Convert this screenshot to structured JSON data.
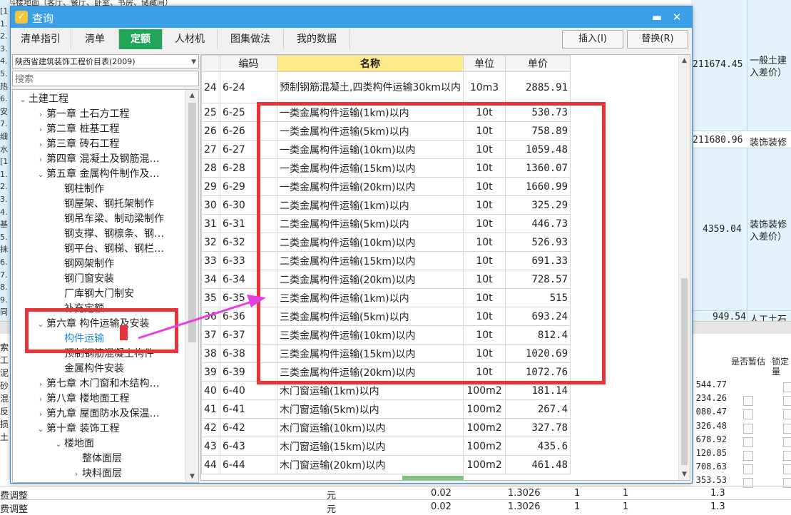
{
  "background": {
    "top_text": "块料楼地面（客厅、餐厅、卧室、书房、储藏间）",
    "left_fragments": [
      "[1",
      "1.",
      "2.",
      "3.",
      "4.",
      "5.",
      "热",
      "6.",
      "安",
      "7.",
      "细",
      "水",
      "[1",
      "1.",
      "2.",
      "3.",
      "4.",
      "基",
      "5.",
      "抹",
      "6.",
      "7.",
      "8.",
      "9.",
      "同",
      "索",
      "工",
      "泥",
      "砂",
      "混",
      "反",
      "损",
      "土"
    ],
    "right_cells": [
      {
        "value": "211674.45",
        "label": "一般土建",
        "label2": "入差价）"
      },
      {
        "value": "211680.96",
        "label": "装饰装修",
        "label2": ""
      },
      {
        "value": "4359.04",
        "label": "装饰装修",
        "label2": "入差价）"
      },
      {
        "value": "949.54",
        "label": "人工土石",
        "label2": ""
      }
    ],
    "lower_headers": {
      "estimate": "是否暂估",
      "lock": "锁定量"
    },
    "lower_values": [
      "544.77",
      "234.26",
      "080.47",
      "326.48",
      "678.92",
      "120.85",
      "708.63",
      "353.53"
    ],
    "bottom_rows": [
      {
        "name": "费调整",
        "unit": "元",
        "v1": "0.02",
        "v2": "1.3026",
        "v3": "1",
        "v4": "1",
        "v5": "1.3"
      },
      {
        "name": "费调整",
        "unit": "元",
        "v1": "0.02",
        "v2": "1.3026",
        "v3": "1",
        "v4": "1",
        "v5": "1.3"
      }
    ]
  },
  "dialog": {
    "title": "查询",
    "minimize_glyph": "▬",
    "close_glyph": "✕",
    "tabs": [
      "清单指引",
      "清单",
      "定额",
      "人材机",
      "图集做法",
      "我的数据"
    ],
    "active_tab": "定额",
    "insert_button": "插入(I)",
    "replace_button": "替换(R)",
    "library_select": "陕西省建筑装饰工程价目表(2009)",
    "search_placeholder": "搜索"
  },
  "tree": [
    {
      "label": "土建工程",
      "toggle": "⌄"
    },
    {
      "label": "第一章  土石方工程",
      "toggle": "›"
    },
    {
      "label": "第二章  桩基工程",
      "toggle": "›"
    },
    {
      "label": "第三章  砖石工程",
      "toggle": "›"
    },
    {
      "label": "第四章  混凝土及钢筋混…",
      "toggle": "›"
    },
    {
      "label": "第五章  金属构件制作及…",
      "toggle": "⌄"
    },
    {
      "label": "钢柱制作",
      "toggle": ""
    },
    {
      "label": "钢屋架、钢托架制作",
      "toggle": ""
    },
    {
      "label": "钢吊车梁、制动梁制作",
      "toggle": ""
    },
    {
      "label": "钢支撑、钢檩条、钢…",
      "toggle": ""
    },
    {
      "label": "钢平台、钢梯、钢栏…",
      "toggle": ""
    },
    {
      "label": "钢网架制作",
      "toggle": ""
    },
    {
      "label": "钢门窗安装",
      "toggle": ""
    },
    {
      "label": "厂库钢大门制安",
      "toggle": ""
    },
    {
      "label": "补充定额",
      "toggle": ""
    },
    {
      "label": "第六章  构件运输及安装",
      "toggle": "⌄"
    },
    {
      "label": "构件运输",
      "toggle": ""
    },
    {
      "label": "预制钢筋混凝土构件",
      "toggle": ""
    },
    {
      "label": "金属构件安装",
      "toggle": ""
    },
    {
      "label": "第七章  木门窗和木结构…",
      "toggle": "›"
    },
    {
      "label": "第八章  楼地面工程",
      "toggle": "›"
    },
    {
      "label": "第九章  屋面防水及保温…",
      "toggle": "›"
    },
    {
      "label": "第十章  装饰工程",
      "toggle": "⌄"
    },
    {
      "label": "楼地面",
      "toggle": "⌄"
    },
    {
      "label": "整体面层",
      "toggle": ""
    },
    {
      "label": "块料面层",
      "toggle": "›"
    }
  ],
  "table": {
    "headers": {
      "index": "",
      "code": "编码",
      "name": "名称",
      "unit": "单位",
      "price": "单价"
    },
    "rows": [
      {
        "idx": "24",
        "code": "6-24",
        "name": "预制钢筋混凝土,四类构件运输30km以内",
        "unit": "10m3",
        "price": "2885.91"
      },
      {
        "idx": "25",
        "code": "6-25",
        "name": "一类金属构件运输(1km)以内",
        "unit": "10t",
        "price": "530.73"
      },
      {
        "idx": "26",
        "code": "6-26",
        "name": "一类金属构件运输(5km)以内",
        "unit": "10t",
        "price": "758.89"
      },
      {
        "idx": "27",
        "code": "6-27",
        "name": "一类金属构件运输(10km)以内",
        "unit": "10t",
        "price": "1059.48"
      },
      {
        "idx": "28",
        "code": "6-28",
        "name": "一类金属构件运输(15km)以内",
        "unit": "10t",
        "price": "1360.07"
      },
      {
        "idx": "29",
        "code": "6-29",
        "name": "一类金属构件运输(20km)以内",
        "unit": "10t",
        "price": "1660.99"
      },
      {
        "idx": "30",
        "code": "6-30",
        "name": "二类金属构件运输(1km)以内",
        "unit": "10t",
        "price": "325.29"
      },
      {
        "idx": "31",
        "code": "6-31",
        "name": "二类金属构件运输(5km)以内",
        "unit": "10t",
        "price": "446.73"
      },
      {
        "idx": "32",
        "code": "6-32",
        "name": "二类金属构件运输(10km)以内",
        "unit": "10t",
        "price": "526.93"
      },
      {
        "idx": "33",
        "code": "6-33",
        "name": "二类金属构件运输(15km)以内",
        "unit": "10t",
        "price": "691.33"
      },
      {
        "idx": "34",
        "code": "6-34",
        "name": "二类金属构件运输(20km)以内",
        "unit": "10t",
        "price": "728.57"
      },
      {
        "idx": "35",
        "code": "6-35",
        "name": "三类金属构件运输(1km)以内",
        "unit": "10t",
        "price": "515"
      },
      {
        "idx": "36",
        "code": "6-36",
        "name": "三类金属构件运输(5km)以内",
        "unit": "10t",
        "price": "693.24"
      },
      {
        "idx": "37",
        "code": "6-37",
        "name": "三类金属构件运输(10km)以内",
        "unit": "10t",
        "price": "812.4"
      },
      {
        "idx": "38",
        "code": "6-38",
        "name": "三类金属构件运输(15km)以内",
        "unit": "10t",
        "price": "1020.69"
      },
      {
        "idx": "39",
        "code": "6-39",
        "name": "三类金属构件运输(20km)以内",
        "unit": "10t",
        "price": "1072.76"
      },
      {
        "idx": "40",
        "code": "6-40",
        "name": "木门窗运输(1km)以内",
        "unit": "100m2",
        "price": "181.14"
      },
      {
        "idx": "41",
        "code": "6-41",
        "name": "木门窗运输(5km)以内",
        "unit": "100m2",
        "price": "267.4"
      },
      {
        "idx": "42",
        "code": "6-42",
        "name": "木门窗运输(10km)以内",
        "unit": "100m2",
        "price": "327.78"
      },
      {
        "idx": "43",
        "code": "6-43",
        "name": "木门窗运输(15km)以内",
        "unit": "100m2",
        "price": "435.6"
      },
      {
        "idx": "44",
        "code": "6-44",
        "name": "木门窗运输(20km)以内",
        "unit": "100m2",
        "price": "461.48"
      }
    ]
  },
  "colors": {
    "accent": "#39a0e8",
    "active_tab": "#21a55b",
    "annotation": "#e8333b",
    "arrow": "#e83de0",
    "header_highlight": "#ffe98a"
  }
}
